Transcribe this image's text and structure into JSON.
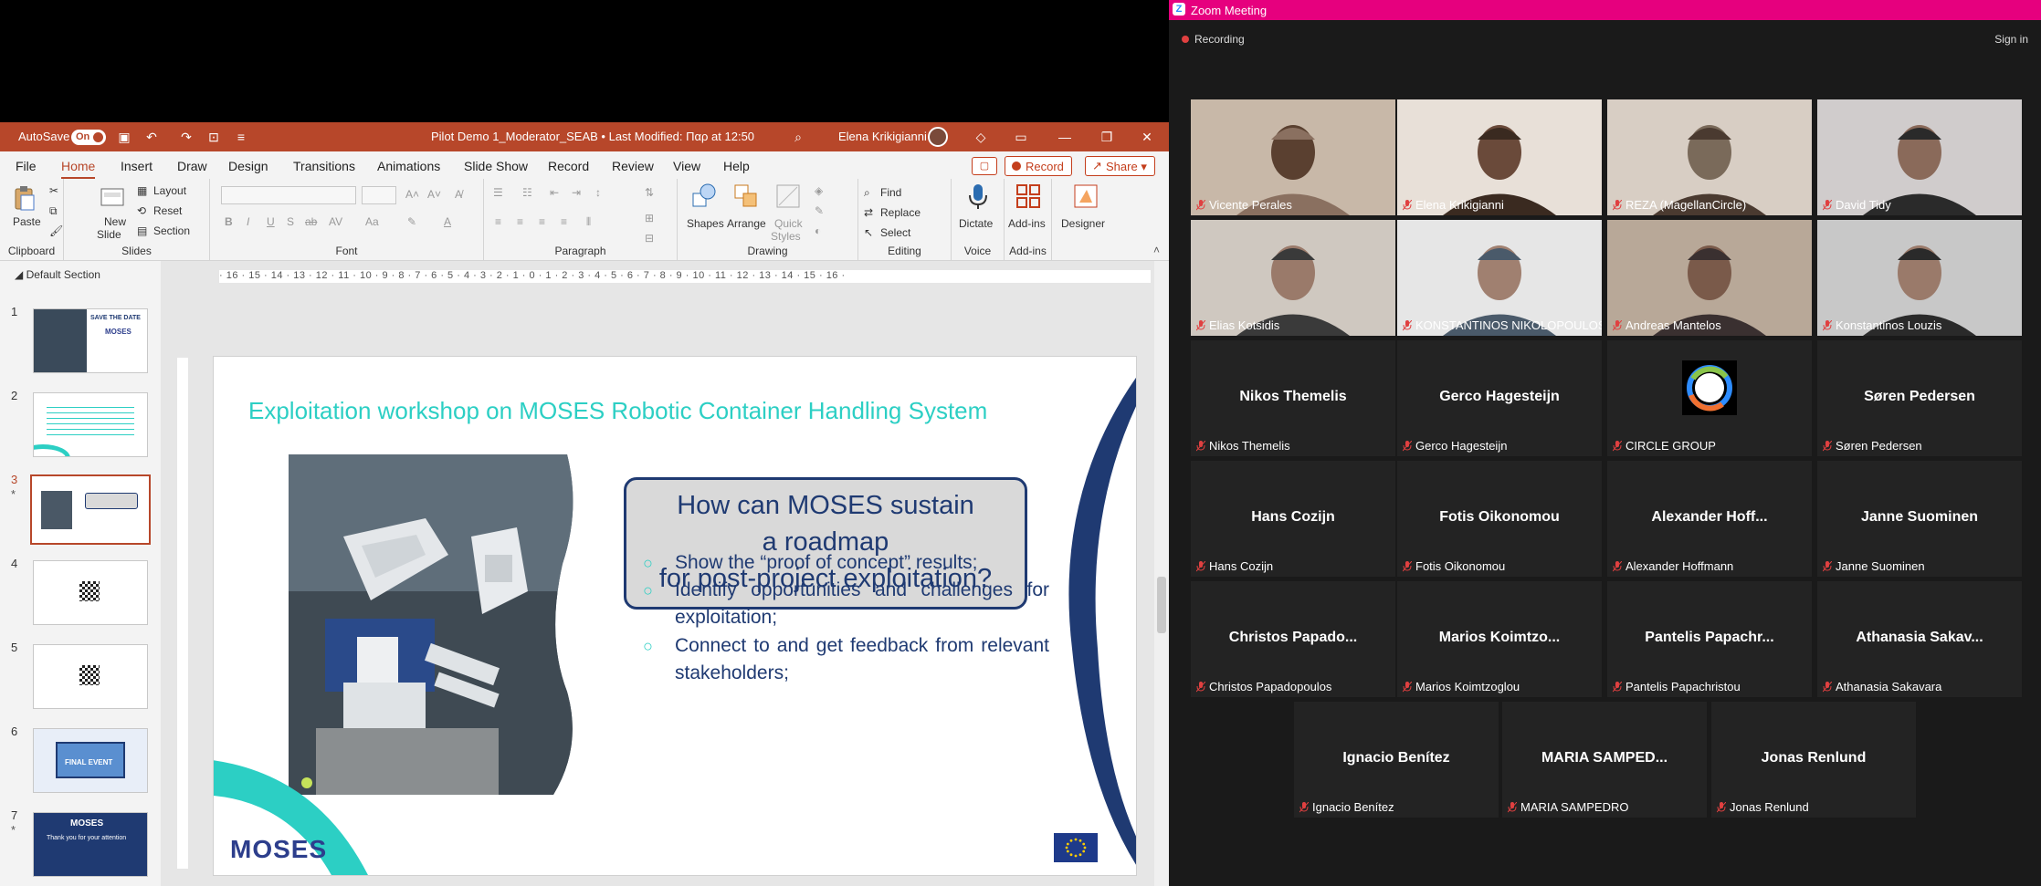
{
  "ppt": {
    "autosave_label": "AutoSave",
    "autosave_state": "On",
    "doc_title": "Pilot Demo 1_Moderator_SEAB  •  Last Modified: Παρ at 12:50",
    "user_name": "Elena Krikigianni",
    "menu": [
      "File",
      "Home",
      "Insert",
      "Draw",
      "Design",
      "Transitions",
      "Animations",
      "Slide Show",
      "Record",
      "Review",
      "View",
      "Help"
    ],
    "record_btn": "Record",
    "share_btn": "Share",
    "ribbon": {
      "paste": "Paste",
      "clipboard": "Clipboard",
      "new_slide": "New",
      "new_slide2": "Slide",
      "layout": "Layout",
      "reset": "Reset",
      "section": "Section",
      "slides": "Slides",
      "font": "Font",
      "paragraph": "Paragraph",
      "shapes": "Shapes",
      "arrange": "Arrange",
      "quick": "Quick",
      "styles": "Styles",
      "drawing": "Drawing",
      "find": "Find",
      "replace": "Replace",
      "select": "Select",
      "editing": "Editing",
      "dictate": "Dictate",
      "voice": "Voice",
      "addins": "Add-ins",
      "addins_grp": "Add-ins",
      "designer": "Designer"
    },
    "section_name": "Default Section",
    "thumb_numbers": [
      "1",
      "2",
      "3",
      "4",
      "5",
      "6",
      "7"
    ],
    "thumb1": "SAVE THE DATE",
    "thumb6": "FINAL EVENT",
    "thumb7": "Thank you for your attention",
    "ruler": "· 16 · 15 · 14 · 13 · 12 · 11 · 10 · 9 · 8 · 7 · 6 · 5 · 4 · 3 · 2 · 1 · 0 · 1 · 2 · 3 · 4 · 5 · 6 · 7 · 8 · 9 · 10 · 11 · 12 · 13 · 14 · 15 · 16 ·",
    "slide": {
      "title": "Exploitation workshop on MOSES Robotic Container Handling System",
      "callout_l1": "How can MOSES sustain",
      "callout_l2": "a roadmap",
      "callout_l3": "for post-project exploitation?",
      "bullets": [
        "Show the “proof of concept” results;",
        "Identify opportunities and challenges for exploitation;",
        "Connect to and get feedback from relevant stakeholders;"
      ],
      "logo": "MOSES"
    }
  },
  "zoom": {
    "title": "Zoom Meeting",
    "recording": "Recording",
    "signin": "Sign in",
    "video_tiles": [
      {
        "name": "Vicente Perales"
      },
      {
        "name": "Elena Krikigianni"
      },
      {
        "name": "REZA (MagellanCircle)"
      },
      {
        "name": "David Tidy"
      },
      {
        "name": "Elias Kotsidis"
      },
      {
        "name": "KONSTANTINOS NIKOLOPOULOS"
      },
      {
        "name": "Andreas Mantelos"
      },
      {
        "name": "Konstantinos Louzis"
      }
    ],
    "name_tiles": [
      {
        "display": "Nikos Themelis",
        "name": "Nikos Themelis"
      },
      {
        "display": "Gerco Hagesteijn",
        "name": "Gerco Hagesteijn"
      },
      {
        "display": "",
        "name": "CIRCLE GROUP"
      },
      {
        "display": "Søren Pedersen",
        "name": "Søren Pedersen"
      },
      {
        "display": "Hans Cozijn",
        "name": "Hans Cozijn"
      },
      {
        "display": "Fotis Oikonomou",
        "name": "Fotis Oikonomou"
      },
      {
        "display": "Alexander  Hoff...",
        "name": "Alexander Hoffmann"
      },
      {
        "display": "Janne Suominen",
        "name": "Janne Suominen"
      },
      {
        "display": "Christos  Papado...",
        "name": "Christos Papadopoulos"
      },
      {
        "display": "Marios  Koimtzo...",
        "name": "Marios Koimtzoglou"
      },
      {
        "display": "Pantelis  Papachr...",
        "name": "Pantelis Papachristou"
      },
      {
        "display": "Athanasia  Sakav...",
        "name": "Athanasia Sakavara"
      },
      {
        "display": "Ignacio Benítez",
        "name": "Ignacio Benítez"
      },
      {
        "display": "MARIA  SAMPED...",
        "name": "MARIA SAMPEDRO"
      },
      {
        "display": "Jonas Renlund",
        "name": "Jonas Renlund"
      }
    ],
    "colors": {
      "titlebar": "#e6007e",
      "speaker": "#c6e35a",
      "tile": "#232323"
    }
  }
}
